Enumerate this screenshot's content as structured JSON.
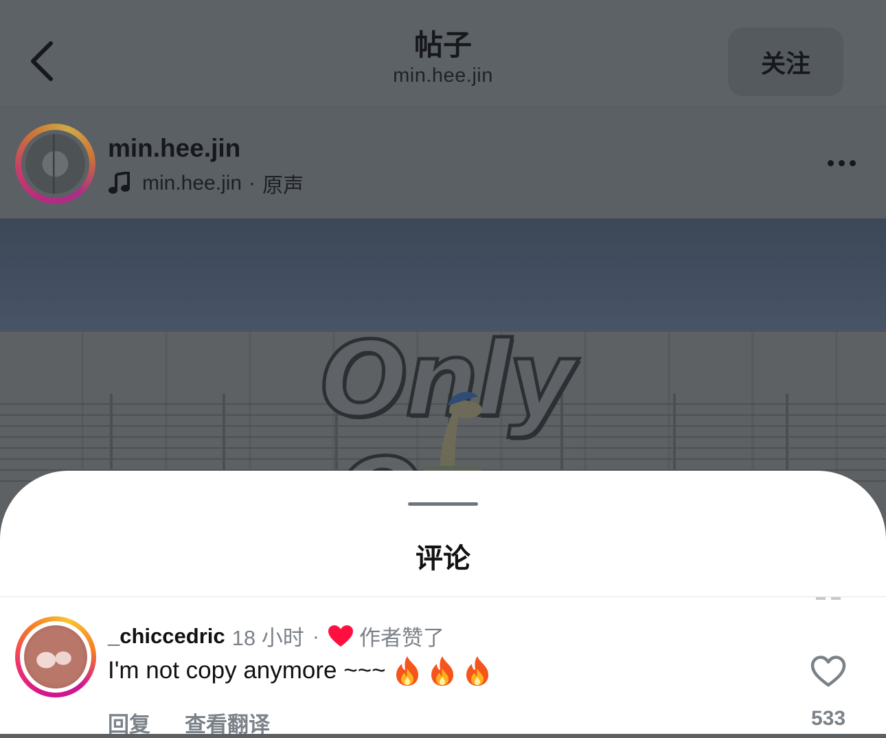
{
  "header": {
    "back_icon": "chevron-left-icon",
    "title": "帖子",
    "subtitle": "min.hee.jin",
    "follow_label": "关注"
  },
  "post": {
    "author": "min.hee.jin",
    "audio_author": "min.hee.jin",
    "audio_separator": "·",
    "audio_label": "原声",
    "music_icon": "music-note-icon",
    "more_icon": "more-horizontal-icon",
    "media_overlay_text": "Only One"
  },
  "comments_sheet": {
    "title": "评论",
    "comments": [
      {
        "username": "_chiccedric",
        "time": "18 小时",
        "separator": "·",
        "liked_by_author_label": "作者赞了",
        "text": "I'm not copy anymore ~~~",
        "emoji": [
          "fire",
          "fire",
          "fire"
        ],
        "reply_label": "回复",
        "translate_label": "查看翻译",
        "like_count": "533"
      }
    ]
  },
  "colors": {
    "dim_overlay": "#5b6065",
    "sheet_bg": "#ffffff",
    "heart_red": "#ff0f3f",
    "muted_text": "#7b8188"
  }
}
